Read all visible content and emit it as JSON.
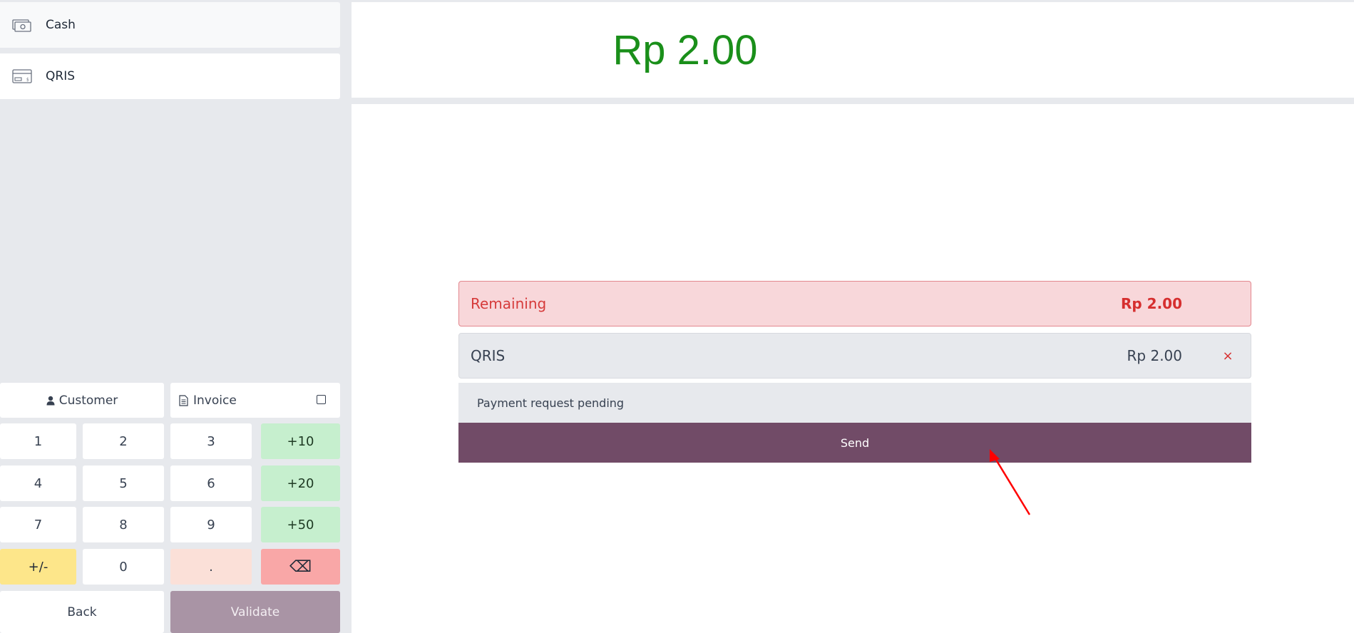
{
  "payment_methods": [
    {
      "label": "Cash",
      "icon": "cash-icon"
    },
    {
      "label": "QRIS",
      "icon": "card-icon"
    }
  ],
  "controls": {
    "customer_label": "Customer",
    "invoice_label": "Invoice",
    "back_label": "Back",
    "validate_label": "Validate"
  },
  "numpad": {
    "keys": [
      "1",
      "2",
      "3",
      "+10",
      "4",
      "5",
      "6",
      "+20",
      "7",
      "8",
      "9",
      "+50",
      "+/-",
      "0",
      ".",
      "⌫"
    ]
  },
  "summary": {
    "total": "Rp 2.00",
    "remaining_label": "Remaining",
    "remaining_value": "Rp 2.00"
  },
  "payment_line": {
    "method": "QRIS",
    "amount": "Rp 2.00",
    "delete_symbol": "×",
    "status": "Payment request pending",
    "send_label": "Send"
  },
  "colors": {
    "total_green": "#1a8f1a",
    "remaining_red": "#d62f2f",
    "send_purple": "#714b67",
    "validate_disabled": "#a994a5"
  }
}
